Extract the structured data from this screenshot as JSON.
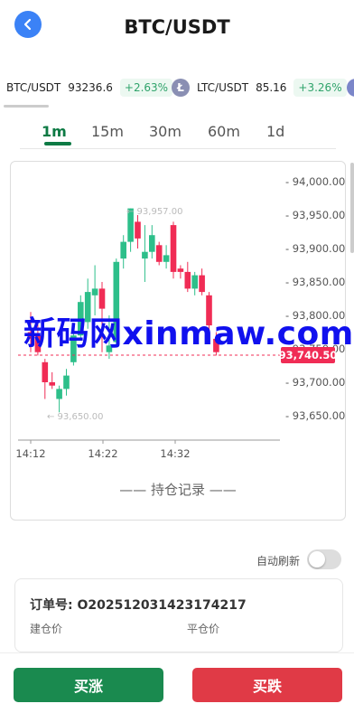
{
  "header": {
    "title": "BTC/USDT"
  },
  "ticker": [
    {
      "pair": "BTC/USDT",
      "price": "93236.6",
      "change": "+2.63%"
    },
    {
      "pair": "LTC/USDT",
      "price": "85.16",
      "change": "+3.26%",
      "icon": "Ł"
    }
  ],
  "tabs": [
    "1m",
    "15m",
    "30m",
    "60m",
    "1d"
  ],
  "active_tab": "1m",
  "chart_data": {
    "type": "candlestick",
    "x_ticks": [
      "14:12",
      "14:22",
      "14:32"
    ],
    "y_ticks": [
      93650,
      93700,
      93750,
      93800,
      93850,
      93900,
      93950,
      94000
    ],
    "y_tick_labels": [
      "93,650.00",
      "93,700.00",
      "93,750.00",
      "93,800.00",
      "93,850.00",
      "93,900.00",
      "93,950.00",
      "94,000.00"
    ],
    "high_label": "93,957.00",
    "low_label": "93,650.00",
    "current_price_label": "93,740.50",
    "current_price": 93740.5,
    "ylim": [
      93620,
      94010
    ],
    "candles": [
      {
        "o": 93775,
        "c": 93765,
        "h": 93805,
        "l": 93745
      },
      {
        "o": 93770,
        "c": 93745,
        "h": 93790,
        "l": 93740
      },
      {
        "o": 93730,
        "c": 93700,
        "h": 93735,
        "l": 93675
      },
      {
        "o": 93700,
        "c": 93695,
        "h": 93715,
        "l": 93690
      },
      {
        "o": 93675,
        "c": 93690,
        "h": 93695,
        "l": 93655
      },
      {
        "o": 93690,
        "c": 93710,
        "h": 93720,
        "l": 93680
      },
      {
        "o": 93730,
        "c": 93770,
        "h": 93780,
        "l": 93725
      },
      {
        "o": 93770,
        "c": 93820,
        "h": 93830,
        "l": 93765
      },
      {
        "o": 93790,
        "c": 93835,
        "h": 93855,
        "l": 93780
      },
      {
        "o": 93830,
        "c": 93840,
        "h": 93875,
        "l": 93800
      },
      {
        "o": 93840,
        "c": 93810,
        "h": 93850,
        "l": 93745
      },
      {
        "o": 93745,
        "c": 93755,
        "h": 93800,
        "l": 93735
      },
      {
        "o": 93760,
        "c": 93880,
        "h": 93885,
        "l": 93755
      },
      {
        "o": 93885,
        "c": 93910,
        "h": 93920,
        "l": 93870
      },
      {
        "o": 93910,
        "c": 93960,
        "h": 93960,
        "l": 93895
      },
      {
        "o": 93940,
        "c": 93915,
        "h": 93950,
        "l": 93900
      },
      {
        "o": 93885,
        "c": 93895,
        "h": 93935,
        "l": 93850
      },
      {
        "o": 93895,
        "c": 93920,
        "h": 93935,
        "l": 93885
      },
      {
        "o": 93905,
        "c": 93880,
        "h": 93910,
        "l": 93875
      },
      {
        "o": 93880,
        "c": 93890,
        "h": 93905,
        "l": 93870
      },
      {
        "o": 93935,
        "c": 93865,
        "h": 93940,
        "l": 93855
      },
      {
        "o": 93870,
        "c": 93865,
        "h": 93875,
        "l": 93855
      },
      {
        "o": 93865,
        "c": 93840,
        "h": 93880,
        "l": 93835
      },
      {
        "o": 93840,
        "c": 93860,
        "h": 93865,
        "l": 93830
      },
      {
        "o": 93860,
        "c": 93835,
        "h": 93870,
        "l": 93830
      },
      {
        "o": 93830,
        "c": 93785,
        "h": 93835,
        "l": 93770
      },
      {
        "o": 93765,
        "c": 93745,
        "h": 93775,
        "l": 93740
      }
    ]
  },
  "records_label": "—— 持仓记录 ——",
  "auto_refresh_label": "自动刷新",
  "order": {
    "number_label": "订单号: O2025120314231742​17",
    "open_price_label": "建仓价",
    "close_price_label": "平仓价"
  },
  "buttons": {
    "buy_label": "买涨",
    "sell_label": "买跌"
  },
  "watermark": "新码网xinmaw.com",
  "colors": {
    "up": "#2dbf8a",
    "down": "#f02c55",
    "accent": "#0d7a44",
    "buy": "#1a8a4f",
    "sell": "#e03a46"
  }
}
